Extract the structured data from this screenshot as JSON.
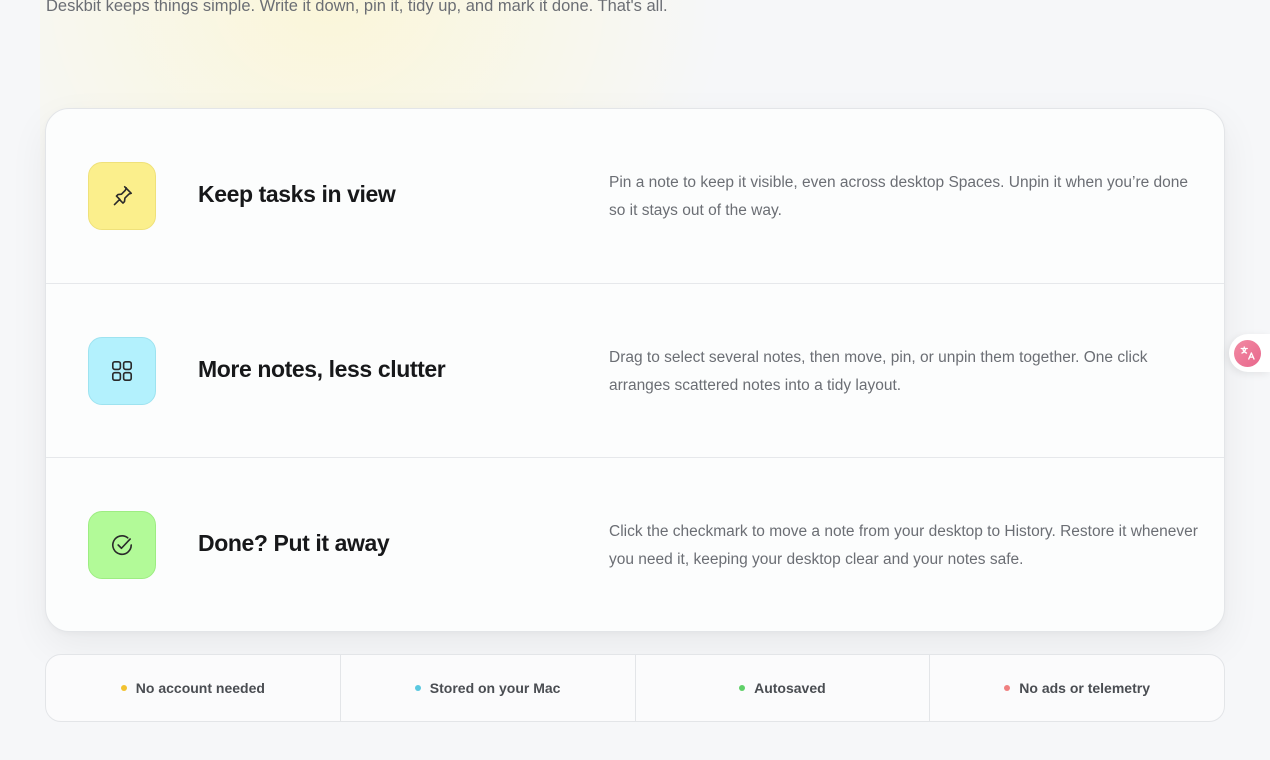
{
  "intro": {
    "text": "Deskbit keeps things simple. Write it down, pin it, tidy up, and mark it done. That's all."
  },
  "features": [
    {
      "icon": "pin-icon",
      "color": "#fbef8c",
      "title": "Keep tasks in view",
      "description": "Pin a note to keep it visible, even across desktop Spaces. Unpin it when you’re done so it stays out of the way."
    },
    {
      "icon": "grid-icon",
      "color": "#b3f1fd",
      "title": "More notes, less clutter",
      "description": "Drag to select several notes, then move, pin, or unpin them together. One click arranges scattered notes into a tidy layout."
    },
    {
      "icon": "check-circle-icon",
      "color": "#b2fa98",
      "title": "Done? Put it away",
      "description": "Click the checkmark to move a note from your desktop to History. Restore it whenever you need it, keeping your desktop clear and your notes safe."
    }
  ],
  "badges": [
    {
      "label": "No account needed",
      "dot_color": "#f2c230"
    },
    {
      "label": "Stored on your Mac",
      "dot_color": "#5ac8e0"
    },
    {
      "label": "Autosaved",
      "dot_color": "#5fd068"
    },
    {
      "label": "No ads or telemetry",
      "dot_color": "#f08080"
    }
  ],
  "translate_widget": {
    "icon": "translate-icon"
  }
}
